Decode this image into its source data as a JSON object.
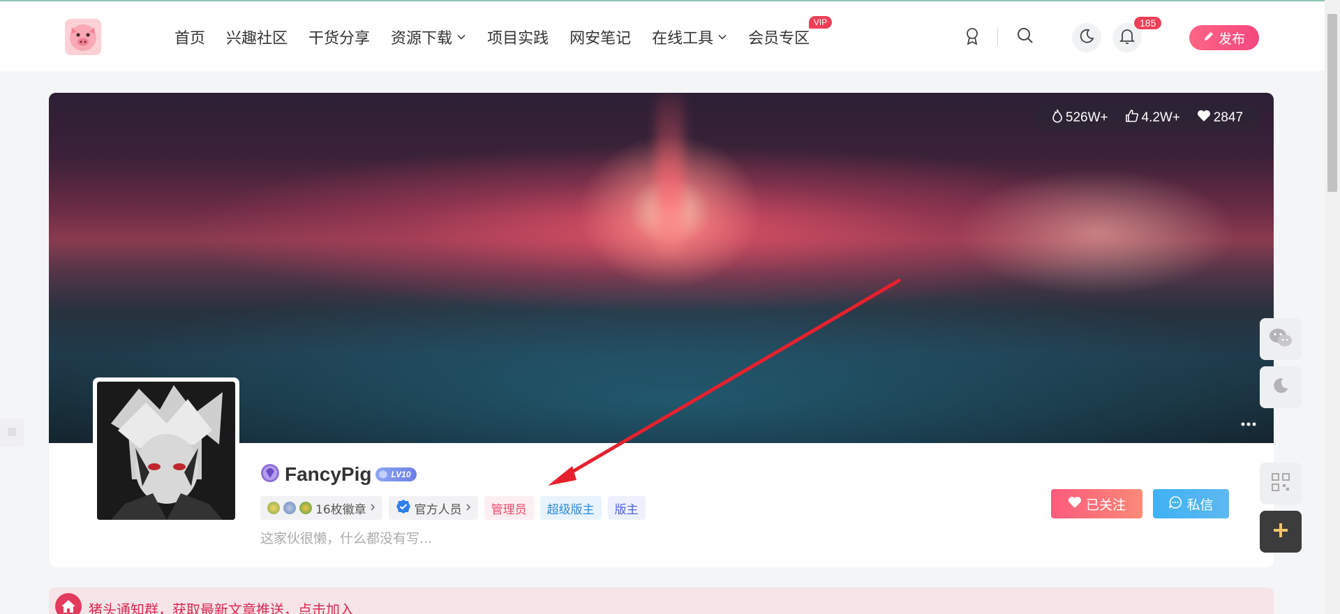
{
  "header": {
    "nav": [
      {
        "label": "首页",
        "dropdown": false
      },
      {
        "label": "兴趣社区",
        "dropdown": false
      },
      {
        "label": "干货分享",
        "dropdown": false
      },
      {
        "label": "资源下载",
        "dropdown": true
      },
      {
        "label": "项目实践",
        "dropdown": false
      },
      {
        "label": "网安笔记",
        "dropdown": false
      },
      {
        "label": "在线工具",
        "dropdown": true
      },
      {
        "label": "会员专区",
        "dropdown": false
      }
    ],
    "vip_badge": "VIP",
    "notification_count": "185",
    "publish_label": "发布"
  },
  "profile": {
    "stats": {
      "views": "526W+",
      "likes": "4.2W+",
      "favorites": "2847"
    },
    "username": "FancyPig",
    "level": "LV10",
    "tags": {
      "medals": "16枚徽章",
      "official": "官方人员",
      "admin": "管理员",
      "super_moderator": "超级版主",
      "moderator": "版主"
    },
    "bio": "这家伙很懒，什么都没有写...",
    "follow_label": "已关注",
    "message_label": "私信"
  },
  "notice": {
    "text": "猪头通知群，获取最新文章推送，点击加入"
  },
  "colors": {
    "accent_pink": "#f5477e",
    "notice_red": "#d62a52",
    "message_blue": "#3fb2f5",
    "annotation_arrow": "#e8202e"
  },
  "icons": {
    "logo": "pig-logo-icon",
    "medal": "medal-icon",
    "search": "search-icon",
    "theme": "moon-icon",
    "notify": "bell-icon",
    "publish": "pencil-icon",
    "fire": "fire-icon",
    "like": "thumb-up-icon",
    "heart": "heart-icon",
    "chat": "chat-icon",
    "wechat": "wechat-icon",
    "qrcode": "qrcode-icon",
    "plus": "plus-icon",
    "home": "home-icon"
  }
}
